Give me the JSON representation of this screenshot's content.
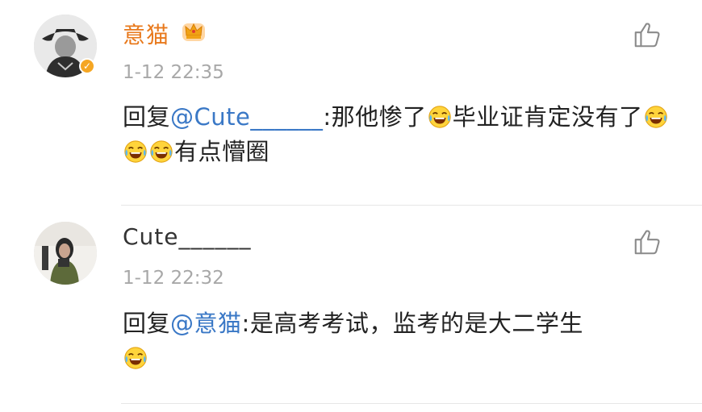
{
  "comments": [
    {
      "username": "意猫",
      "verified_badge": "✓",
      "time": "1-12 22:35",
      "reply_prefix": "回复",
      "mention": "@Cute______",
      "colon": ":",
      "text_a": "那他惨了",
      "text_b": "毕业证肯定没有了",
      "text_c": "有点懵圈",
      "name_color": "#e8791c",
      "icons": [
        "crown-icon",
        "like-icon",
        "laughing-crying-emoji"
      ]
    },
    {
      "username": "Cute______",
      "time": "1-12 22:32",
      "reply_prefix": "回复",
      "mention": "@意猫",
      "colon": ":",
      "text_a": "是高考考试，监考的是大二学生",
      "name_color": "#333333",
      "icons": [
        "like-icon",
        "laughing-crying-emoji"
      ]
    }
  ],
  "colors": {
    "mention": "#3a78c6",
    "time": "#a8a8a8",
    "divider": "#e6e6e6"
  }
}
